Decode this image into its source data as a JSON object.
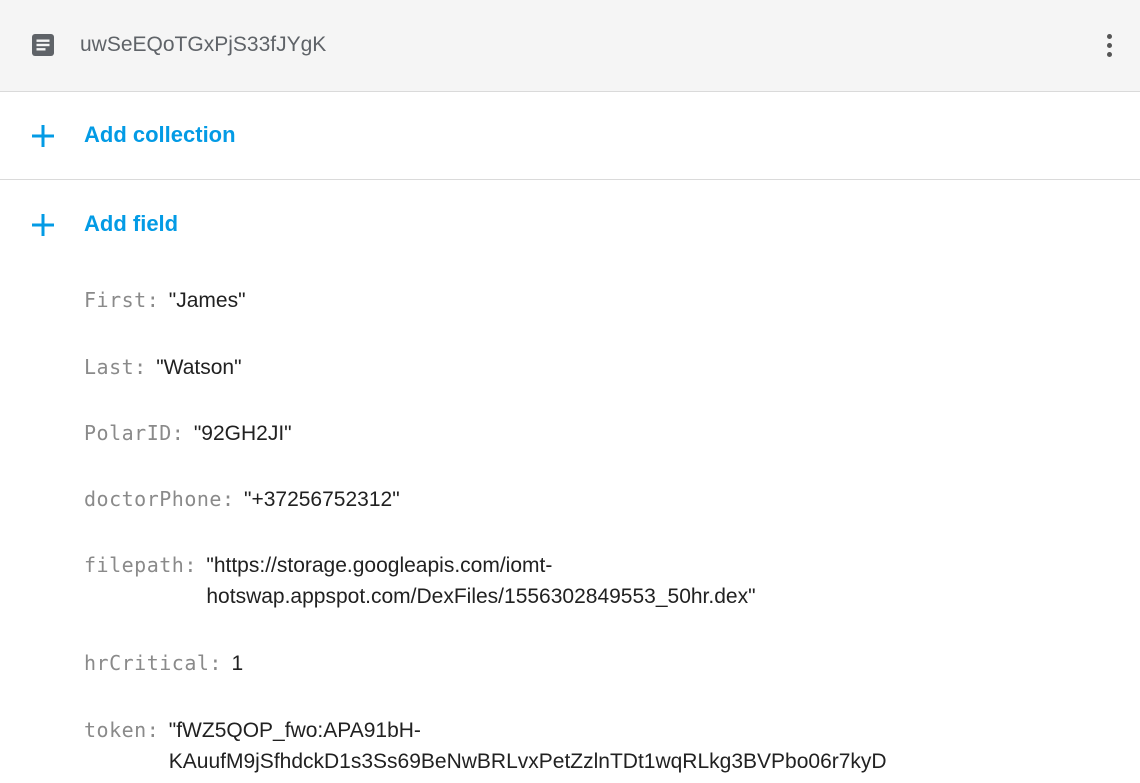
{
  "document": {
    "id": "uwSeEQoTGxPjS33fJYgK"
  },
  "actions": {
    "add_collection": "Add collection",
    "add_field": "Add field"
  },
  "fields": [
    {
      "key": "First",
      "value": "\"James\""
    },
    {
      "key": "Last",
      "value": "\"Watson\""
    },
    {
      "key": "PolarID",
      "value": "\"92GH2JI\""
    },
    {
      "key": "doctorPhone",
      "value": "\"+37256752312\""
    },
    {
      "key": "filepath",
      "value": "\"https://storage.googleapis.com/iomt-\nhotswap.appspot.com/DexFiles/1556302849553_50hr.dex\""
    },
    {
      "key": "hrCritical",
      "value": "1"
    },
    {
      "key": "token",
      "value": "\"fWZ5QOP_fwo:APA91bH-\nKAuufM9jSfhdckD1s3Ss69BeNwBRLvxPetZzlnTDt1wqRLkg3BVPbo06r7kyD"
    }
  ],
  "colors": {
    "accent": "#039be5",
    "header_bg": "#f5f5f5",
    "field_key": "#8a8a8a",
    "field_value": "#212121"
  },
  "icons": {
    "document": "document-icon",
    "more": "more-vert-icon",
    "add": "plus-icon"
  }
}
